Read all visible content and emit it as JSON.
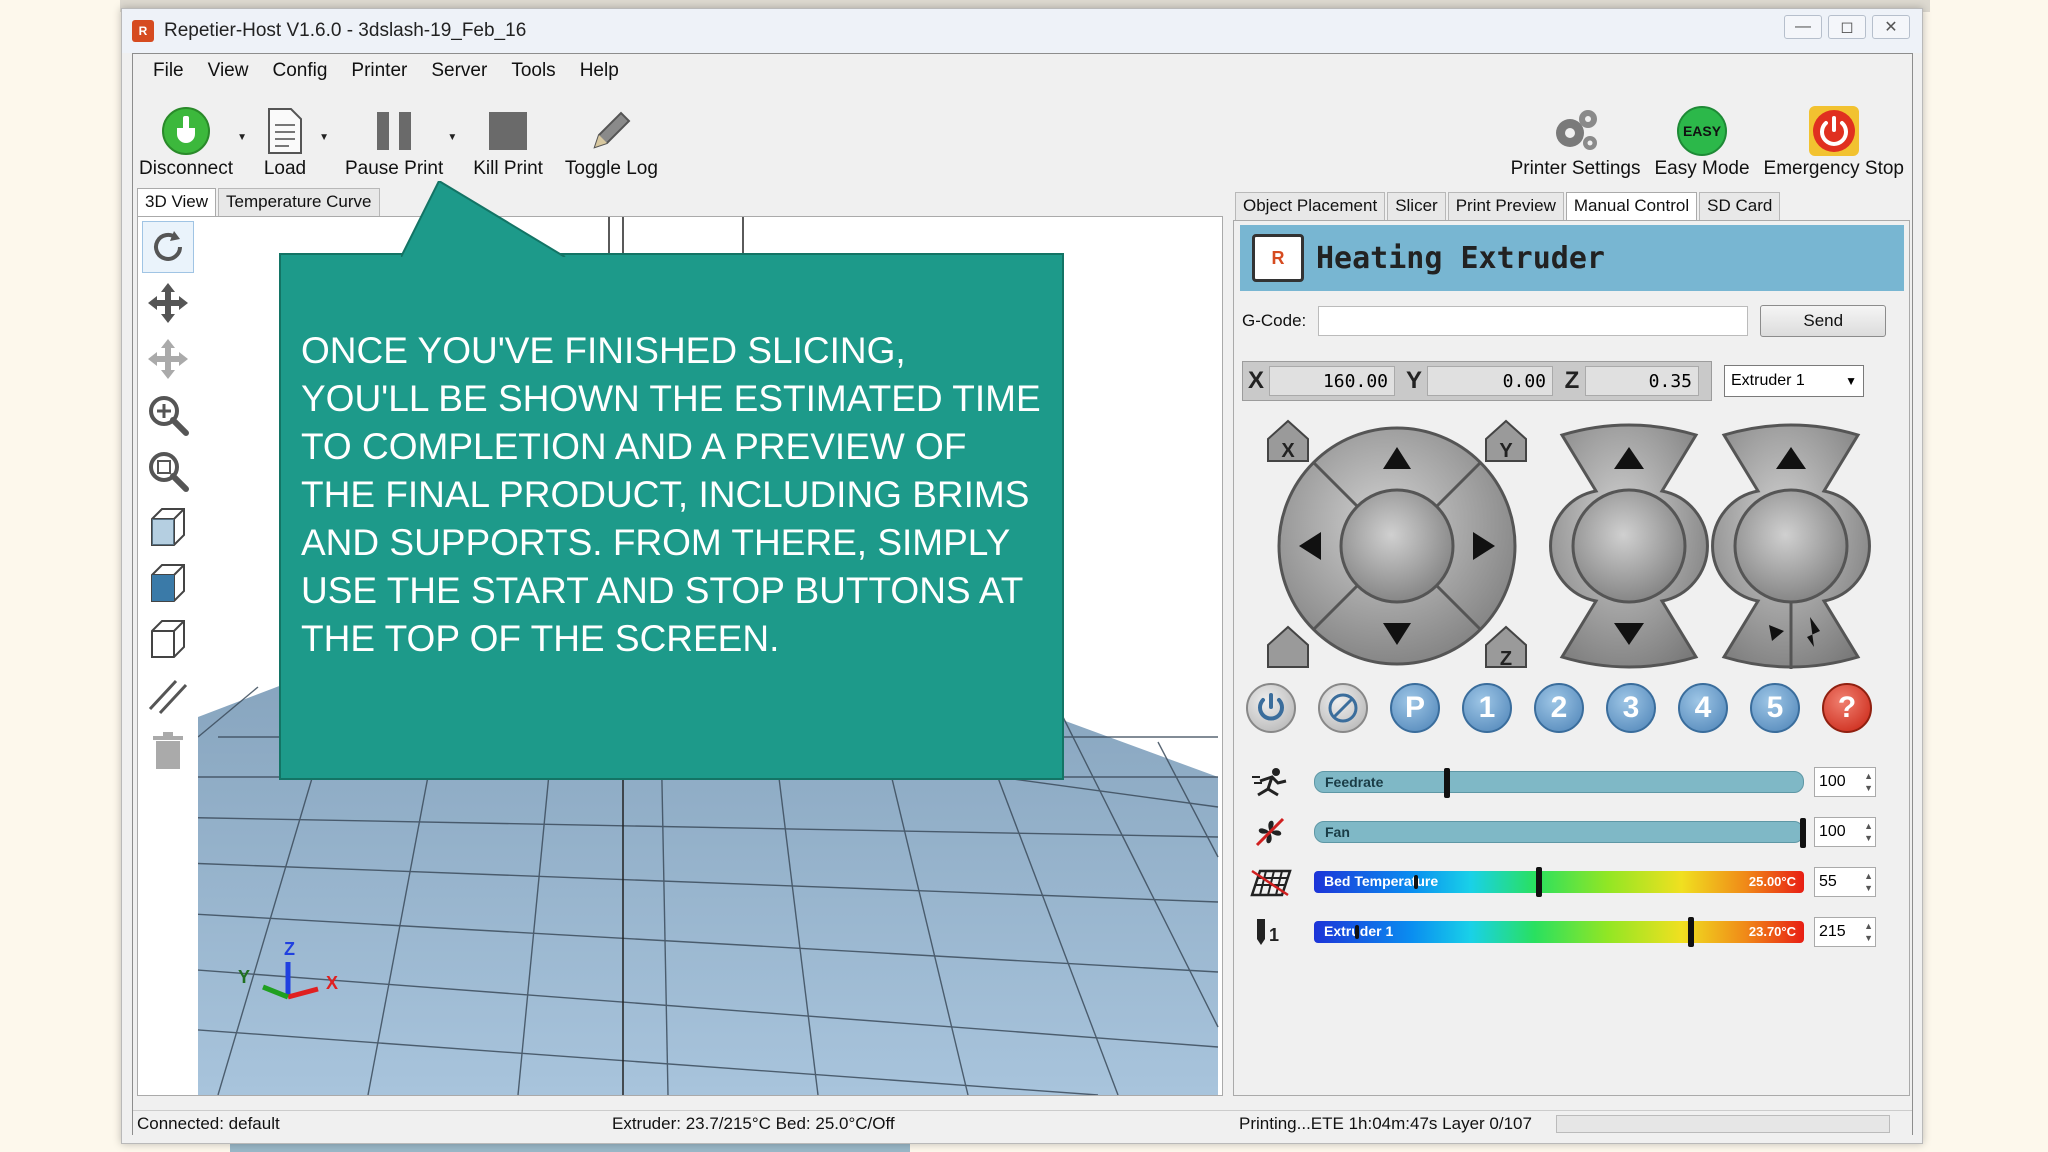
{
  "window": {
    "title": "Repetier-Host V1.6.0 - 3dslash-19_Feb_16"
  },
  "menu": [
    "File",
    "View",
    "Config",
    "Printer",
    "Server",
    "Tools",
    "Help"
  ],
  "toolbar": {
    "disconnect": "Disconnect",
    "load": "Load",
    "pause_print": "Pause Print",
    "kill_print": "Kill Print",
    "toggle_log": "Toggle Log",
    "printer_settings": "Printer Settings",
    "easy_mode": "Easy Mode",
    "easy_badge": "EASY",
    "emergency_stop": "Emergency Stop"
  },
  "left_tabs": [
    "3D View",
    "Temperature Curve"
  ],
  "right_tabs": [
    "Object Placement",
    "Slicer",
    "Print Preview",
    "Manual Control",
    "SD Card"
  ],
  "callout": {
    "text": "ONCE YOU'VE FINISHED SLICING, YOU'LL BE SHOWN THE ESTIMATED TIME TO COMPLETION AND A PREVIEW OF THE FINAL PRODUCT, INCLUDING BRIMS AND SUPPORTS. FROM THERE, SIMPLY USE THE START AND STOP BUTTONS AT THE TOP OF THE SCREEN."
  },
  "manual": {
    "banner": "Heating Extruder",
    "gcode_label": "G-Code:",
    "gcode_value": "",
    "send": "Send",
    "x_label": "X",
    "x": "160.00",
    "y_label": "Y",
    "y": "0.00",
    "z_label": "Z",
    "z": "0.35",
    "extruder_select": "Extruder 1",
    "buttons": [
      "P",
      "1",
      "2",
      "3",
      "4",
      "5",
      "?"
    ],
    "feedrate": {
      "label": "Feedrate",
      "value": "100",
      "level": 0.27
    },
    "fan": {
      "label": "Fan",
      "value": "100",
      "level": 1.0
    },
    "bed": {
      "label": "Bed Temperature",
      "current": "25.00°C",
      "value": "55",
      "target": 0.46,
      "cursor": 0.21
    },
    "extruder": {
      "label": "Extruder 1",
      "current": "23.70°C",
      "value": "215",
      "target": 0.77,
      "cursor": 0.09
    }
  },
  "status": {
    "connection": "Connected: default",
    "temps": "Extruder: 23.7/215°C Bed: 25.0°C/Off",
    "printing": "Printing...ETE 1h:04m:47s Layer 0/107",
    "progress": 0.0
  },
  "colors": {
    "callout": "#1d9a8a",
    "banner": "#78b6d2",
    "disconnect": "#3cb83c",
    "emergency": "#e03020"
  }
}
